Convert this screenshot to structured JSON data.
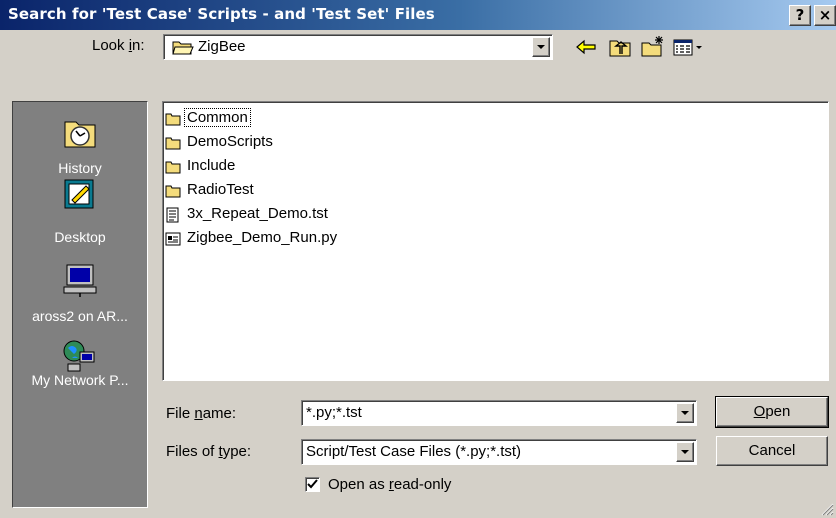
{
  "window": {
    "title": "Search for 'Test Case' Scripts - and 'Test Set' Files",
    "help_label": "?",
    "close_label": "×"
  },
  "lookin": {
    "label_pre": "Look ",
    "label_u": "i",
    "label_post": "n:",
    "value": "ZigBee"
  },
  "places": [
    {
      "label": "History",
      "icon": "history-icon"
    },
    {
      "label": "Desktop",
      "icon": "desktop-icon"
    },
    {
      "label": "aross2 on AR...",
      "icon": "network-drive-icon"
    },
    {
      "label": "My Network P...",
      "icon": "network-places-icon"
    }
  ],
  "files": [
    {
      "name": "Common",
      "type": "folder",
      "icon": "folder-icon"
    },
    {
      "name": "DemoScripts",
      "type": "folder",
      "icon": "folder-icon"
    },
    {
      "name": "Include",
      "type": "folder",
      "icon": "folder-icon"
    },
    {
      "name": "RadioTest",
      "type": "folder",
      "icon": "folder-icon"
    },
    {
      "name": "3x_Repeat_Demo.tst",
      "type": "file",
      "icon": "text-file-icon"
    },
    {
      "name": "Zigbee_Demo_Run.py",
      "type": "file",
      "icon": "python-file-icon"
    }
  ],
  "filename": {
    "label_pre": "File ",
    "label_u": "n",
    "label_post": "ame:",
    "value": "*.py;*.tst"
  },
  "filetype": {
    "label_pre": "Files of ",
    "label_u": "t",
    "label_post": "ype:",
    "value": "Script/Test Case Files (*.py;*.tst)"
  },
  "buttons": {
    "open_u": "O",
    "open_rest": "pen",
    "cancel": "Cancel"
  },
  "readonly": {
    "checked": true,
    "label_pre": "Open as ",
    "label_u": "r",
    "label_post": "ead-only"
  }
}
